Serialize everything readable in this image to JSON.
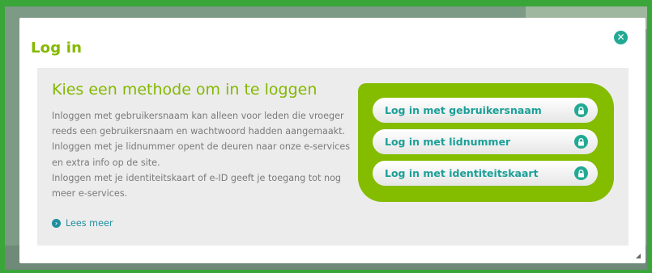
{
  "modal": {
    "title": "Log in",
    "close_icon": "close-icon"
  },
  "panel": {
    "heading": "Kies een methode om in te loggen",
    "paragraphs": [
      "Inloggen met gebruikersnaam kan alleen voor leden die vroeger reeds een gebruikersnaam en wachtwoord hadden aangemaakt.",
      "Inloggen met je lidnummer opent de deuren naar onze e-services en extra info op de site.",
      "Inloggen met je identiteitskaart of e-ID geeft je toegang tot nog meer e-services."
    ],
    "more_link": "Lees meer"
  },
  "methods": [
    {
      "label": "Log in met gebruikersnaam",
      "icon": "lock-icon"
    },
    {
      "label": "Log in met lidnummer",
      "icon": "lock-icon"
    },
    {
      "label": "Log in met identiteitskaart",
      "icon": "lock-icon"
    }
  ],
  "colors": {
    "brand_green": "#84bc00",
    "accent_teal": "#22a993",
    "text_gray": "#7a7a7a"
  }
}
